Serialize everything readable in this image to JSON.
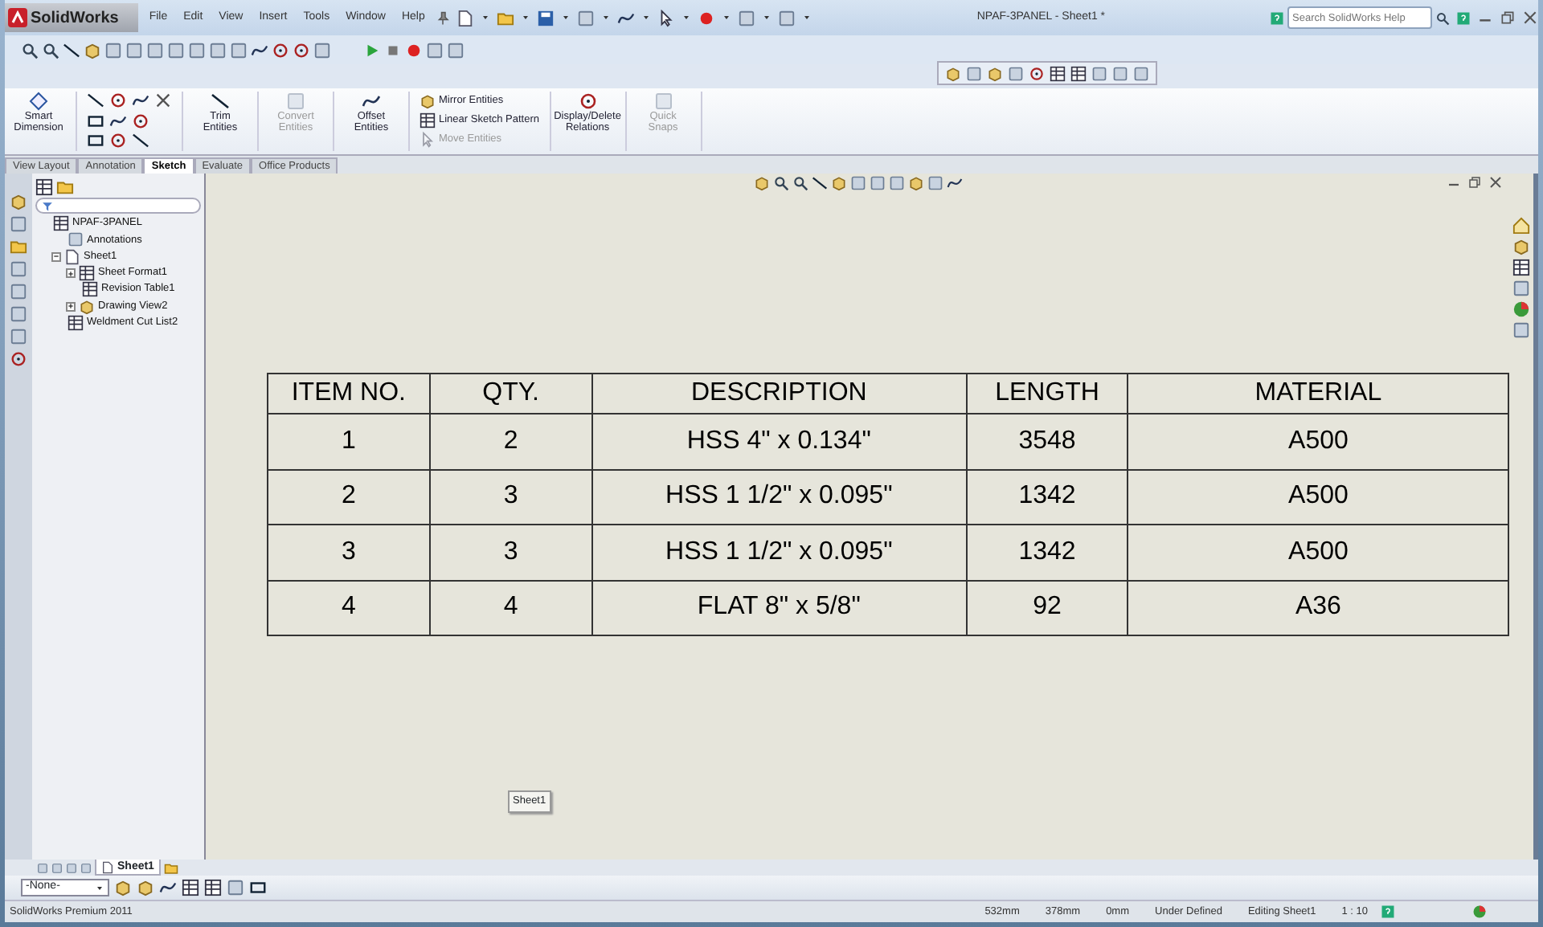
{
  "window": {
    "app_name": "SolidWorks",
    "title": "NPAF-3PANEL - Sheet1 *"
  },
  "menu": [
    "File",
    "Edit",
    "View",
    "Insert",
    "Tools",
    "Window",
    "Help"
  ],
  "search": {
    "placeholder": "Search SolidWorks Help"
  },
  "command_manager": {
    "tools": [
      {
        "kind": "large",
        "label": "Smart Dimension",
        "disabled": false
      },
      {
        "kind": "sketch_grid"
      },
      {
        "kind": "large",
        "label": "Trim Entities",
        "disabled": false
      },
      {
        "kind": "large",
        "label": "Convert Entities",
        "disabled": true
      },
      {
        "kind": "large",
        "label": "Offset Entities",
        "disabled": false
      },
      {
        "kind": "stack",
        "items": [
          {
            "label": "Mirror Entities",
            "disabled": false
          },
          {
            "label": "Linear Sketch Pattern",
            "disabled": false
          },
          {
            "label": "Move Entities",
            "disabled": true
          }
        ]
      },
      {
        "kind": "large",
        "label": "Display/Delete Relations",
        "disabled": false
      },
      {
        "kind": "large",
        "label": "Quick Snaps",
        "disabled": true
      }
    ]
  },
  "tabs": [
    {
      "label": "View Layout",
      "selected": false
    },
    {
      "label": "Annotation",
      "selected": false
    },
    {
      "label": "Sketch",
      "selected": true
    },
    {
      "label": "Evaluate",
      "selected": false
    },
    {
      "label": "Office Products",
      "selected": false
    }
  ],
  "feature_tree": {
    "items": [
      {
        "label": "NPAF-3PANEL",
        "children": [
          {
            "label": "Annotations"
          },
          {
            "label": "Sheet1",
            "expanded": true,
            "children": [
              {
                "label": "Sheet Format1",
                "expanded": false
              },
              {
                "label": "Revision Table1"
              },
              {
                "label": "Drawing View2",
                "expanded": false
              }
            ]
          },
          {
            "label": "Weldment Cut List2"
          }
        ]
      }
    ]
  },
  "bom_table": {
    "columns": [
      "ITEM NO.",
      "QTY.",
      "DESCRIPTION",
      "LENGTH",
      "MATERIAL"
    ],
    "rows": [
      [
        "1",
        "2",
        "HSS 4\" x 0.134\"",
        "3548",
        "A500"
      ],
      [
        "2",
        "3",
        "HSS 1 1/2\" x 0.095\"",
        "1342",
        "A500"
      ],
      [
        "3",
        "3",
        "HSS 1 1/2\" x 0.095\"",
        "1342",
        "A500"
      ],
      [
        "4",
        "4",
        "FLAT 8\" x 5/8\"",
        "92",
        "A36"
      ]
    ]
  },
  "sheet_label": "Sheet1",
  "sheet_tabs": [
    {
      "label": "Sheet1",
      "selected": true
    }
  ],
  "layer_select": {
    "value": "-None-"
  },
  "status_bar": {
    "product": "SolidWorks Premium 2011",
    "fields": [
      "532mm",
      "378mm",
      "0mm",
      "Under Defined",
      "Editing Sheet1",
      "1 : 10"
    ]
  }
}
